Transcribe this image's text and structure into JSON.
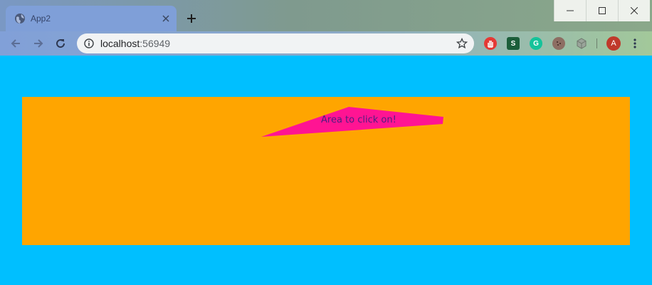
{
  "browser": {
    "tab": {
      "title": "App2",
      "favicon": "globe-icon",
      "close": "close-icon"
    },
    "new_tab": "plus-icon",
    "window_controls": [
      "minimize-icon",
      "maximize-icon",
      "close-icon"
    ],
    "toolbar": {
      "back": "back-arrow-icon",
      "forward": "forward-arrow-icon",
      "reload": "reload-icon",
      "url_host": "localhost",
      "url_port": ":56949",
      "bookmark": "star-icon",
      "extensions": [
        "adblock-icon",
        "stylus-icon",
        "grammarly-icon",
        "cookie-icon",
        "cube-extension-icon"
      ],
      "avatar_letter": "A",
      "menu": "kebab-menu-icon"
    }
  },
  "page": {
    "background_color": "#00bfff",
    "panel_color": "#ffa500",
    "shape_color": "#ff1493",
    "click_area_label": "Area to click on!"
  }
}
